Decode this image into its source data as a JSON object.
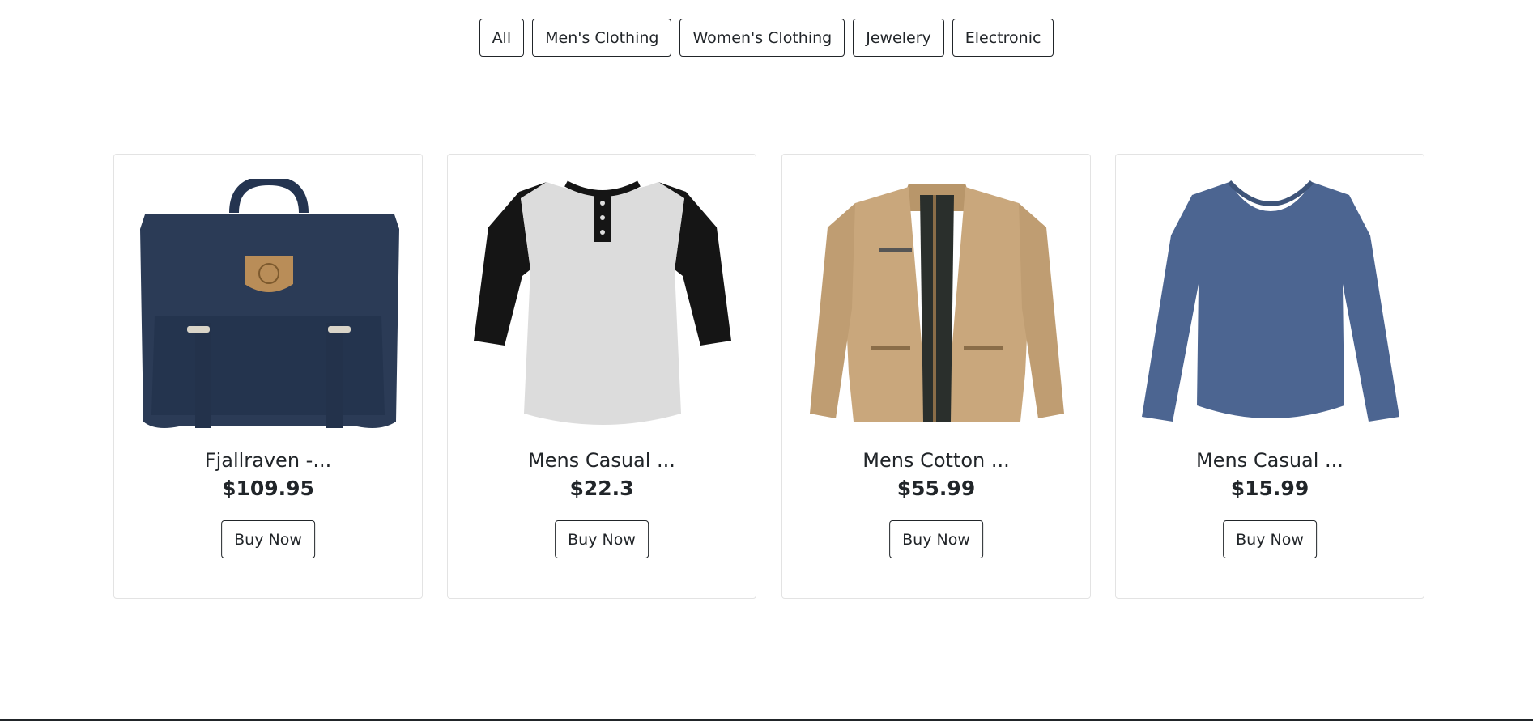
{
  "filters": {
    "all": "All",
    "mens": "Men's Clothing",
    "womens": "Women's Clothing",
    "jewelery": "Jewelery",
    "electronic": "Electronic"
  },
  "products": [
    {
      "title": "Fjallraven -...",
      "price": "$109.95",
      "button": "Buy Now",
      "image": "backpack-image"
    },
    {
      "title": "Mens Casual ...",
      "price": "$22.3",
      "button": "Buy Now",
      "image": "raglan-shirt-image"
    },
    {
      "title": "Mens Cotton ...",
      "price": "$55.99",
      "button": "Buy Now",
      "image": "cotton-jacket-image"
    },
    {
      "title": "Mens Casual ...",
      "price": "$15.99",
      "button": "Buy Now",
      "image": "long-sleeve-shirt-image"
    }
  ],
  "colors": {
    "text": "#212529",
    "card_border": "#e3e3e3",
    "backpack": "#2b3b56",
    "jacket": "#c9a77c",
    "long_sleeve": "#4c6591"
  }
}
